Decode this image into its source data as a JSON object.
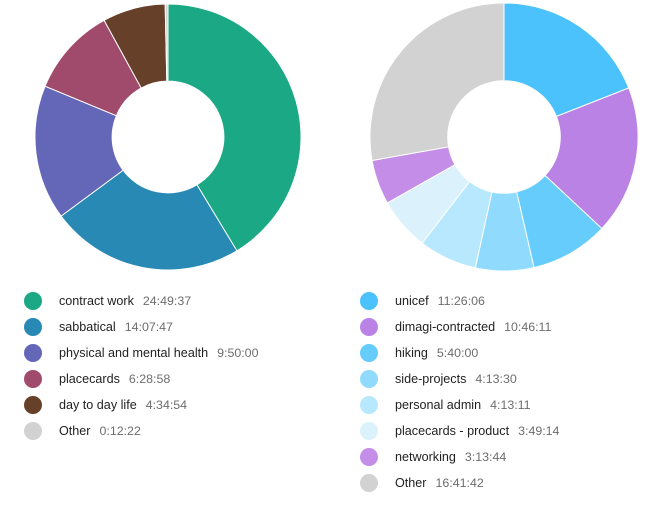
{
  "colors": {
    "background": "#ffffff",
    "label_text": "#1f1f1f",
    "value_text": "#6d6d6d",
    "other_gray": "#d2d2d2"
  },
  "chart_data": [
    {
      "type": "pie",
      "variant": "donut",
      "position": "left",
      "title": "",
      "start_angle_deg": 0,
      "direction": "clockwise",
      "inner_radius_ratio": 0.42,
      "legend": "bottom-left",
      "units": "H:MM:SS",
      "total": "60:03:38",
      "categories": [
        "contract work",
        "sabbatical",
        "physical and mental health",
        "placecards",
        "day to day life",
        "Other"
      ],
      "values": [
        "24:49:37",
        "14:07:47",
        "9:50:00",
        "6:28:58",
        "4:34:54",
        "0:12:22"
      ],
      "seconds": [
        89377,
        50867,
        35400,
        23338,
        16494,
        742
      ],
      "percents": [
        41.33,
        23.52,
        16.37,
        10.79,
        7.63,
        0.34
      ],
      "colors": [
        "#1ba884",
        "#2889b5",
        "#6467b8",
        "#a04a6c",
        "#664028",
        "#d2d2d2"
      ]
    },
    {
      "type": "pie",
      "variant": "donut",
      "position": "right",
      "title": "",
      "start_angle_deg": 0,
      "direction": "clockwise",
      "inner_radius_ratio": 0.42,
      "legend": "bottom-right",
      "units": "H:MM:SS",
      "total": "60:03:38",
      "categories": [
        "unicef",
        "dimagi-contracted",
        "hiking",
        "side-projects",
        "personal admin",
        "placecards - product",
        "networking",
        "Other"
      ],
      "values": [
        "11:26:06",
        "10:46:11",
        "5:40:00",
        "4:13:30",
        "4:13:11",
        "3:49:14",
        "3:13:44",
        "16:41:42"
      ],
      "seconds": [
        41166,
        38771,
        20400,
        15210,
        15191,
        13754,
        11624,
        60102
      ],
      "percents": [
        19.04,
        17.93,
        9.43,
        7.03,
        7.02,
        6.36,
        5.38,
        27.8
      ],
      "colors": [
        "#4cc2fc",
        "#bb82e6",
        "#66ccfc",
        "#8fdafd",
        "#b8e8fd",
        "#dbf2fd",
        "#c48ee8",
        "#d2d2d2"
      ]
    }
  ],
  "left_chart": {
    "legend_items": [
      {
        "label": "contract work",
        "value": "24:49:37",
        "color": "#1ba884"
      },
      {
        "label": "sabbatical",
        "value": "14:07:47",
        "color": "#2889b5"
      },
      {
        "label": "physical and mental health",
        "value": "9:50:00",
        "color": "#6467b8"
      },
      {
        "label": "placecards",
        "value": "6:28:58",
        "color": "#a04a6c"
      },
      {
        "label": "day to day life",
        "value": "4:34:54",
        "color": "#664028"
      },
      {
        "label": "Other",
        "value": "0:12:22",
        "color": "#d2d2d2"
      }
    ]
  },
  "right_chart": {
    "legend_items": [
      {
        "label": "unicef",
        "value": "11:26:06",
        "color": "#4cc2fc"
      },
      {
        "label": "dimagi-contracted",
        "value": "10:46:11",
        "color": "#bb82e6"
      },
      {
        "label": "hiking",
        "value": "5:40:00",
        "color": "#66ccfc"
      },
      {
        "label": "side-projects",
        "value": "4:13:30",
        "color": "#8fdafd"
      },
      {
        "label": "personal admin",
        "value": "4:13:11",
        "color": "#b8e8fd"
      },
      {
        "label": "placecards - product",
        "value": "3:49:14",
        "color": "#dbf2fd"
      },
      {
        "label": "networking",
        "value": "3:13:44",
        "color": "#c48ee8"
      },
      {
        "label": "Other",
        "value": "16:41:42",
        "color": "#d2d2d2"
      }
    ]
  }
}
